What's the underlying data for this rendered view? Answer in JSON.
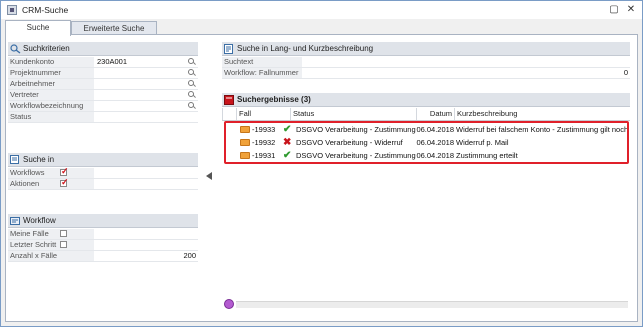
{
  "window": {
    "title": "CRM-Suche",
    "minimize_icon": "minimize-icon",
    "close_icon": "close-icon"
  },
  "tabs": [
    {
      "label": "Suche",
      "active": true
    },
    {
      "label": "Erweiterte Suche",
      "active": false
    }
  ],
  "criteria": {
    "title": "Suchkriterien",
    "fields": [
      {
        "label": "Kundenkonto",
        "value": "230A001",
        "lookup": true
      },
      {
        "label": "Projektnummer",
        "value": "",
        "lookup": true
      },
      {
        "label": "Arbeitnehmer",
        "value": "",
        "lookup": true
      },
      {
        "label": "Vertreter",
        "value": "",
        "lookup": true
      },
      {
        "label": "Workflowbezeichnung",
        "value": "",
        "lookup": true
      },
      {
        "label": "Status",
        "value": "",
        "lookup": false
      }
    ]
  },
  "search_in": {
    "title": "Suche in",
    "options": [
      {
        "label": "Workflows",
        "checked": true
      },
      {
        "label": "Aktionen",
        "checked": true
      }
    ]
  },
  "workflow": {
    "title": "Workflow",
    "options": [
      {
        "label": "Meine Fälle",
        "checked": false
      },
      {
        "label": "Letzter Schritt",
        "checked": false
      },
      {
        "label": "Anzahl x Fälle",
        "value": "200"
      }
    ]
  },
  "description_search": {
    "title": "Suche in Lang- und Kurzbeschreibung",
    "fields": [
      {
        "label": "Suchtext",
        "value": ""
      },
      {
        "label": "Workflow: Fallnummer",
        "value": "0"
      }
    ]
  },
  "results": {
    "title": "Suchergebnisse (3)",
    "columns": [
      "Fall",
      "Status",
      "Datum",
      "Kurzbeschreibung"
    ],
    "rows": [
      {
        "fall": "-19933",
        "status_icon": "check-icon",
        "status": "DSGVO Verarbeitung - Zustimmung",
        "date": "06.04.2018",
        "desc": "Widerruf bei falschem Konto - Zustimmung gilt noch"
      },
      {
        "fall": "-19932",
        "status_icon": "cross-icon",
        "status": "DSGVO Verarbeitung - Widerruf",
        "date": "06.04.2018",
        "desc": "Widerruf p. Mail"
      },
      {
        "fall": "-19931",
        "status_icon": "check-icon",
        "status": "DSGVO Verarbeitung - Zustimmung",
        "date": "06.04.2018",
        "desc": "Zustimmung erteilt"
      }
    ]
  },
  "colors": {
    "highlight": "#e0202a",
    "check": "#2f9a2f",
    "cross": "#c8141b",
    "checkbox_mark": "#d0141b"
  }
}
